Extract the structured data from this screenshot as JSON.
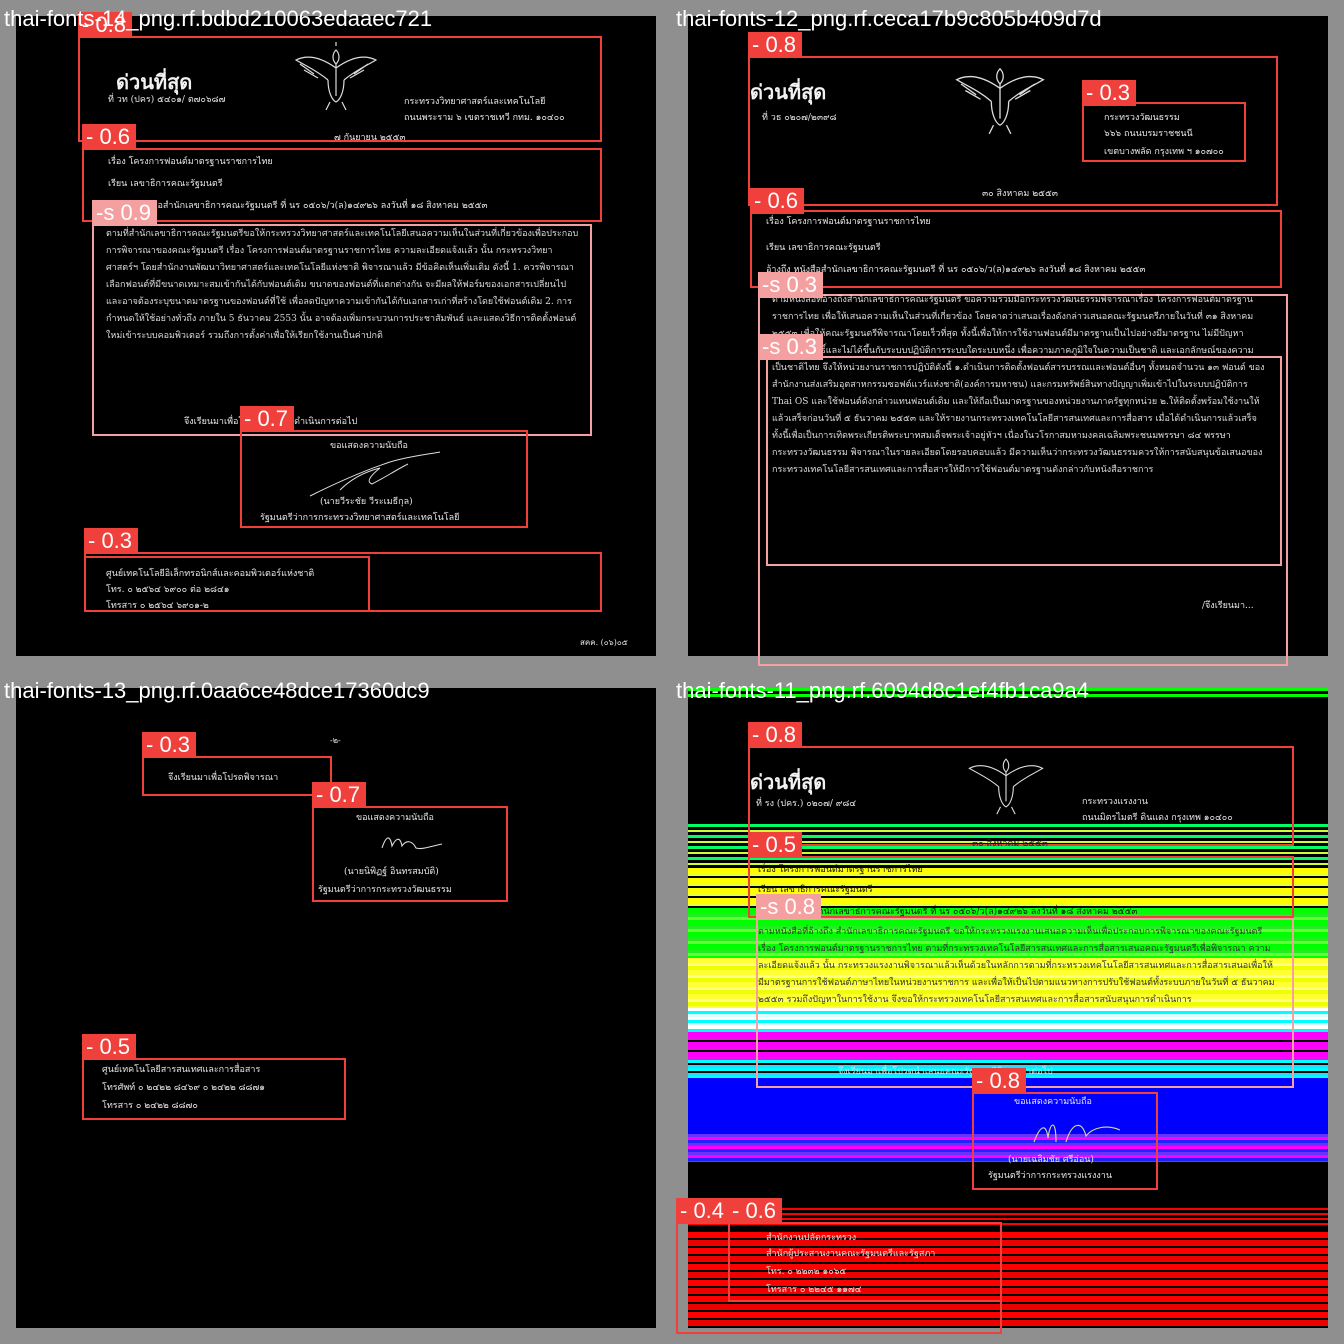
{
  "panels": [
    {
      "title": "thai-fonts-14_png.rf.bdbd210063edaaec721",
      "doc": {
        "urgent": "ด่วนที่สุด",
        "ref_no": "ที่ วท (ปคร) ๕๔๐๑/ ต๗๐๖๘๗",
        "agency": "กระทรวงวิทยาศาสตร์และเทคโนโลยี",
        "address": "ถนนพระราม ๖ เขตราชเทวี กทม. ๑๐๔๐๐",
        "date": "๗ กันยายน ๒๕๕๓",
        "subject": "เรื่อง   โครงการฟอนต์มาตรฐานราชการไทย",
        "to": "เรียน   เลขาธิการคณะรัฐมนตรี",
        "ref": "อ้างถึง หนังสือสำนักเลขาธิการคณะรัฐมนตรี ที่ นร ๐๕๐๖/ว(ล)๑๔๙๒๖ ลงวันที่ ๑๘ สิงหาคม ๒๕๕๓",
        "body": "ตามที่สำนักเลขาธิการคณะรัฐมนตรีขอให้กระทรวงวิทยาศาสตร์และเทคโนโลยีเสนอความเห็นในส่วนที่เกี่ยวข้องเพื่อประกอบการพิจารณาของคณะรัฐมนตรี เรื่อง โครงการฟอนต์มาตรฐานราชการไทย ความละเอียดแจ้งแล้ว นั้น  กระทรวงวิทยาศาสตร์ฯ โดยสำนักงานพัฒนาวิทยาศาสตร์และเทคโนโลยีแห่งชาติ พิจารณาแล้ว มีข้อคิดเห็นเพิ่มเติม ดังนี้  1. ควรพิจารณาเลือกฟอนต์ที่มีขนาดเหมาะสมเข้ากันได้กับฟอนต์เดิม ขนาดของฟอนต์ที่แตกต่างกัน จะมีผลให้ฟอร์มของเอกสารเปลี่ยนไป และอาจต้องระบุขนาดมาตรฐานของฟอนต์ที่ใช้ เพื่อลดปัญหาความเข้ากันได้กับเอกสารเก่าที่สร้างโดยใช้ฟอนต์เดิม  2. การกำหนดให้ใช้อย่างทั่วถึง ภายใน 5 ธันวาคม 2553 นั้น อาจต้องเพิ่มกระบวนการประชาสัมพันธ์ และแสดงวิธีการติดตั้งฟอนต์ใหม่เข้าระบบคอมพิวเตอร์ รวมถึงการตั้งค่าเพื่อให้เรียกใช้งานเป็นค่าปกติ",
        "closing": "จึงเรียนมาเพื่อโปรดพิจารณาดำเนินการต่อไป",
        "regards": "ขอแสดงความนับถือ",
        "signer": "(นายวีระชัย วีระเมธีกุล)",
        "position": "รัฐมนตรีว่าการกระทรวงวิทยาศาสตร์และเทคโนโลยี",
        "contact_org": "ศูนย์เทคโนโลยีอิเล็กทรอนิกส์และคอมพิวเตอร์แห่งชาติ",
        "tel": "โทร.   ๐ ๒๕๖๔ ๖๙๐๐ ต่อ ๒๘๔๑",
        "fax": "โทรสาร   ๐ ๒๕๖๔ ๖๙๐๑-๒",
        "footer": "สคค. (๐๖)๐๕"
      },
      "detections": [
        {
          "label": "- 0.8",
          "color": "#f0403c"
        },
        {
          "label": "- 0.6",
          "color": "#f0403c"
        },
        {
          "label": "-s 0.9",
          "color": "#f5a0a0"
        },
        {
          "label": "- 0.7",
          "color": "#f0403c"
        },
        {
          "label": "- 0.3",
          "color": "#f0403c"
        }
      ]
    },
    {
      "title": "thai-fonts-12_png.rf.ceca17b9c805b409d7d",
      "doc": {
        "urgent": "ด่วนที่สุด",
        "ref_no": "ที่ วธ ๐๒๐๗/๒๓๙๘",
        "agency": "กระทรวงวัฒนธรรม",
        "address1": "๖๖๖ ถนนบรมราชชนนี",
        "address2": "เขตบางพลัด กรุงเทพ ฯ ๑๐๗๐๐",
        "date": "๓๐  สิงหาคม ๒๕๕๓",
        "subject": "เรื่อง   โครงการฟอนต์มาตรฐานราชการไทย",
        "to": "เรียน   เลขาธิการคณะรัฐมนตรี",
        "ref": "อ้างถึง หนังสือสำนักเลขาธิการคณะรัฐมนตรี ที่ นร ๐๕๐๖/ว(ล)๑๔๙๒๖ ลงวันที่ ๑๘ สิงหาคม ๒๕๕๓",
        "body": "ตามหนังสือที่อ้างถึงสำนักเลขาธิการคณะรัฐมนตรี ขอความร่วมมือกระทรวงวัฒนธรรมพิจารณาเรื่อง โครงการฟอนต์มาตรฐานราชการไทย เพื่อให้เสนอความเห็นในส่วนที่เกี่ยวข้อง โดยคาดว่าเสนอเรื่องดังกล่าวเสนอคณะรัฐมนตรีภายในวันที่ ๓๑ สิงหาคม ๒๕๕๓ เพื่อให้คณะรัฐมนตรีพิจารณาโดยเร็วที่สุด ทั้งนี้เพื่อให้การใช้งานฟอนต์มีมาตรฐานเป็นไปอย่างมีมาตรฐาน ไม่มีปัญหาละเมิดลิขสิทธิ์และไม่ได้ขึ้นกับระบบปฏิบัติการระบบใดระบบหนึ่ง เพื่อความภาคภูมิใจในความเป็นชาติ และเอกลักษณ์ของความเป็นชาติไทย จึงให้หน่วยงานราชการปฏิบัติดังนี้  ๑.ดำเนินการติดตั้งฟอนต์สารบรรณและฟอนต์อื่นๆ ทั้งหมดจำนวน ๑๓ ฟอนต์ ของสำนักงานส่งเสริมอุตสาหกรรมซอฟต์แวร์แห่งชาติ(องค์การมหาชน) และกรมทรัพย์สินทางปัญญาเพิ่มเข้าไปในระบบปฏิบัติการ Thai OS และใช้ฟอนต์ดังกล่าวแทนฟอนต์เดิม และให้ถือเป็นมาตรฐานของหน่วยงานภาครัฐทุกหน่วย  ๒.ให้ติดตั้งพร้อมใช้งานให้แล้วเสร็จก่อนวันที่ ๕ ธันวาคม ๒๕๕๓ และให้รายงานกระทรวงเทคโนโลยีสารสนเทศและการสื่อสาร เมื่อได้ดำเนินการแล้วเสร็จ ทั้งนี้เพื่อเป็นการเทิดพระเกียรติพระบาทสมเด็จพระเจ้าอยู่หัวฯ เนื่องในวโรกาสมหามงคลเฉลิมพระชนมพรรษา ๘๔ พรรษา  กระทรวงวัฒนธรรม พิจารณาในรายละเอียดโดยรอบคอบแล้ว มีความเห็นว่ากระทรวงวัฒนธรรมควรให้การสนับสนุนข้อเสนอของกระทรวงเทคโนโลยีสารสนเทศและการสื่อสารให้มีการใช้ฟอนต์มาตรฐานดังกล่าวกับหนังสือราชการ",
        "closing": "/จึงเรียนมา..."
      },
      "detections": [
        {
          "label": "- 0.8",
          "color": "#f0403c"
        },
        {
          "label": "- 0.3",
          "color": "#f0403c"
        },
        {
          "label": "- 0.6",
          "color": "#f0403c"
        },
        {
          "label": "-s 0.3",
          "color": "#f5a0a0"
        },
        {
          "label": "-s 0.3",
          "color": "#f5a0a0"
        }
      ]
    },
    {
      "title": "thai-fonts-13_png.rf.0aa6ce48dce17360dc9",
      "doc": {
        "page_no": "-๒-",
        "closing": "จึงเรียนมาเพื่อโปรดพิจารณา",
        "regards": "ขอแสดงความนับถือ",
        "signer": "(นายนิพิฏฐ์  อินทรสมบัติ)",
        "position": "รัฐมนตรีว่าการกระทรวงวัฒนธรรม",
        "contact_org": "ศูนย์เทคโนโลยีสารสนเทศและการสื่อสาร",
        "tel": "โทรศัพท์ ๐ ๒๔๒๒ ๘๔๖๙   ๐ ๒๔๒๒ ๘๘๗๑",
        "fax": "โทรสาร   ๐ ๒๔๒๒ ๘๘๗๐"
      },
      "detections": [
        {
          "label": "- 0.3",
          "color": "#f0403c"
        },
        {
          "label": "- 0.7",
          "color": "#f0403c"
        },
        {
          "label": "- 0.5",
          "color": "#f0403c"
        }
      ]
    },
    {
      "title": "thai-fonts-11_png.rf.6094d8c1ef4fb1ca9a4",
      "doc": {
        "urgent": "ด่วนที่สุด",
        "ref_no": "ที่ รง (ปคร.) ๐๒๐๗/ ๙๘๔",
        "agency": "กระทรวงแรงงาน",
        "address": "ถนนมิตรไมตรี ดินแดง กรุงเทพ ๑๐๔๐๐",
        "date": "๓๐ สิงหาคม ๒๕๕๓",
        "subject": "เรื่อง   โครงการฟอนต์มาตรฐานราชการไทย",
        "to": "เรียน   เลขาธิการคณะรัฐมนตรี",
        "ref": "อ้างถึง หนังสือสำนักเลขาธิการคณะรัฐมนตรี ที่ นร ๐๕๐๖/ว(ล)๑๔๙๒๖ ลงวันที่ ๑๘ สิงหาคม ๒๕๕๓",
        "body": "ตามหนังสือที่อ้างถึง สำนักเลขาธิการคณะรัฐมนตรี ขอให้กระทรวงแรงงานเสนอความเห็นเพื่อประกอบการพิจารณาของคณะรัฐมนตรี เรื่อง โครงการฟอนต์มาตรฐานราชการไทย ตามที่กระทรวงเทคโนโลยีสารสนเทศและการสื่อสารเสนอคณะรัฐมนตรีเพื่อพิจารณา ความละเอียดแจ้งแล้ว นั้น  กระทรวงแรงงานพิจารณาแล้วเห็นด้วยในหลักการตามที่กระทรวงเทคโนโลยีสารสนเทศและการสื่อสารเสนอเพื่อให้มีมาตรฐานการใช้ฟอนต์ภาษาไทยในหน่วยงานราชการ และเพื่อให้เป็นไปตามแนวทางการปรับใช้ฟอนต์ทั้งระบบภายในวันที่ ๕ ธันวาคม ๒๕๕๓ รวมถึงปัญหาในการใช้งาน จึงขอให้กระทรวงเทคโนโลยีสารสนเทศและการสื่อสารสนับสนุนการดำเนินการ",
        "closing": "จึงเรียนมาเพื่อโปรดนำเสนอคณะรัฐมนตรีพิจารณาต่อไป",
        "regards": "ขอแสดงความนับถือ",
        "signer": "(นายเฉลิมชัย ศรีอ่อน)",
        "position": "รัฐมนตรีว่าการกระทรวงแรงงาน",
        "contact_org1": "สำนักงานปลัดกระทรวง",
        "contact_org2": "สำนักผู้ประสานงานคณะรัฐมนตรีและรัฐสภา",
        "tel": "โทร. ๐ ๒๒๓๒ ๑๐๖๕",
        "fax": "โทรสาร ๐ ๒๒๔๕ ๑๑๗๔"
      },
      "detections": [
        {
          "label": "- 0.8",
          "color": "#f0403c"
        },
        {
          "label": "- 0.5",
          "color": "#f0403c"
        },
        {
          "label": "-s 0.8",
          "color": "#f5a0a0"
        },
        {
          "label": "- 0.8",
          "color": "#f0403c"
        },
        {
          "label": "- 0.4",
          "color": "#f0403c"
        },
        {
          "label": "- 0.6",
          "color": "#f0403c"
        }
      ]
    }
  ]
}
